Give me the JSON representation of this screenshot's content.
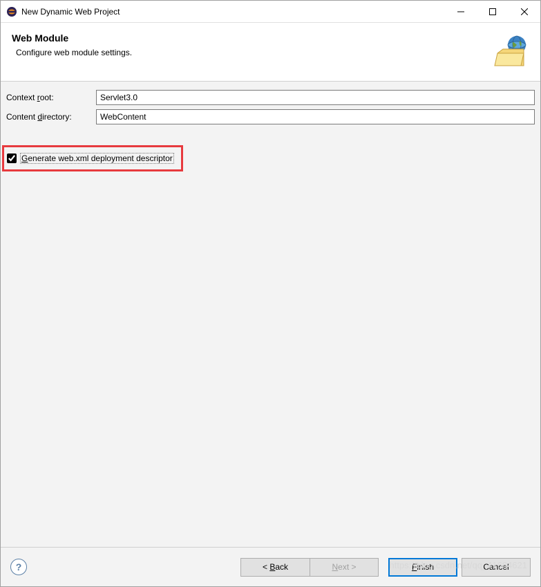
{
  "window": {
    "title": "New Dynamic Web Project"
  },
  "header": {
    "title": "Web Module",
    "description": "Configure web module settings."
  },
  "form": {
    "context_root": {
      "label_pre": "Context ",
      "label_mn": "r",
      "label_post": "oot:",
      "value": "Servlet3.0"
    },
    "content_dir": {
      "label_pre": "Content ",
      "label_mn": "d",
      "label_post": "irectory:",
      "value": "WebContent"
    },
    "generate_checkbox": {
      "label_mn": "G",
      "label_rest": "enerate web.xml deployment descriptor",
      "checked": true
    }
  },
  "footer": {
    "back": {
      "lt": "< ",
      "mn": "B",
      "rest": "ack"
    },
    "next": {
      "mn": "N",
      "rest": "ext >"
    },
    "finish": {
      "mn": "F",
      "rest": "inish"
    },
    "cancel": "Cancel"
  },
  "watermark": "https://blog.csdn.net/qq_41684621"
}
